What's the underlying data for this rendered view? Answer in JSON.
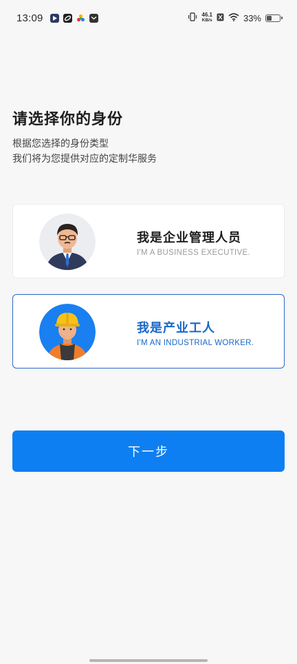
{
  "status_bar": {
    "time": "13:09",
    "net_speed_value": "46.1",
    "net_speed_unit": "KB/s",
    "battery": "33%",
    "battery_level": 0.33,
    "icons": [
      "app-icon-play",
      "app-icon-link",
      "app-icon-color",
      "mail-icon",
      "vibrate-icon",
      "nfc-icon",
      "wifi-icon",
      "battery-icon"
    ]
  },
  "page": {
    "title": "请选择你的身份",
    "subtitle_line1": "根据您选择的身份类型",
    "subtitle_line2": "我们将为您提供对应的定制华服务"
  },
  "options": [
    {
      "title": "我是企业管理人员",
      "subtitle": "I'M A BUSINESS EXECUTIVE.",
      "avatar": "business-executive-avatar",
      "selected": false
    },
    {
      "title": "我是产业工人",
      "subtitle": "I'M AN INDUSTRIAL WORKER.",
      "avatar": "industrial-worker-avatar",
      "selected": true
    }
  ],
  "next_button": {
    "label": "下一步"
  },
  "colors": {
    "accent": "#0d7ff2",
    "selected_text": "#1667c8",
    "selected_border": "#2a67c9",
    "background": "#f7f7f7"
  }
}
